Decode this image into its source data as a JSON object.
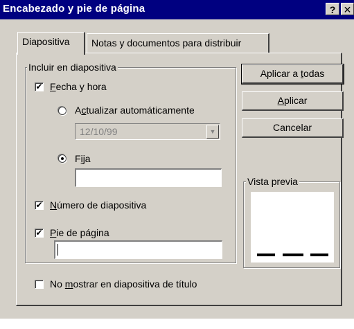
{
  "window": {
    "title": "Encabezado y pie de página",
    "help_glyph": "?",
    "close_glyph": "✕"
  },
  "tabs": [
    {
      "label": "Diapositiva",
      "active": true
    },
    {
      "label": "Notas y documentos para distribuir",
      "active": false
    }
  ],
  "incluir": {
    "legend": "Incluir en diapositiva",
    "fecha_hora": {
      "pre": "",
      "key": "F",
      "post": "echa y hora",
      "checked": true
    },
    "actualizar": {
      "pre": "A",
      "key": "c",
      "post": "tualizar automáticamente",
      "selected": false
    },
    "date_select_value": "12/10/99",
    "fija": {
      "pre": "F",
      "key": "i",
      "post": "ja",
      "selected": true,
      "value": ""
    },
    "numero": {
      "pre": "",
      "key": "N",
      "post": "úmero de diapositiva",
      "checked": true
    },
    "pie": {
      "pre": "",
      "key": "P",
      "post": "ie de página",
      "checked": true,
      "value": ""
    }
  },
  "no_mostrar": {
    "pre": "No ",
    "key": "m",
    "post": "ostrar en diapositiva de título",
    "checked": false
  },
  "buttons": {
    "aplicar_todas": {
      "pre": "Aplicar a ",
      "key": "t",
      "post": "odas"
    },
    "aplicar": {
      "pre": "",
      "key": "A",
      "post": "plicar"
    },
    "cancelar": {
      "label": "Cancelar"
    }
  },
  "vista_previa": {
    "legend": "Vista previa"
  },
  "check_glyph": "✔",
  "icons": {
    "help": "help-icon",
    "close": "close-icon",
    "dropdown": "chevron-down-icon"
  },
  "colors": {
    "titlebar": "#000080",
    "face": "#d4d0c8"
  }
}
